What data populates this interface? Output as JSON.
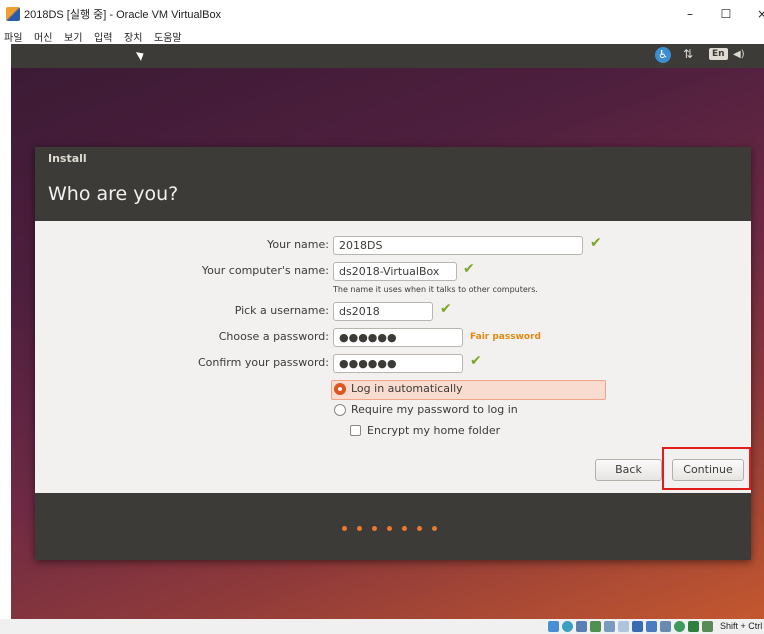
{
  "window": {
    "title": "2018DS [실행 중] - Oracle VM VirtualBox",
    "minimize": "–",
    "maximize": "☐",
    "close": "×"
  },
  "menu": [
    "파일",
    "머신",
    "보기",
    "입력",
    "장치",
    "도움말"
  ],
  "guest_topbar": {
    "language": "En",
    "network_glyph": "⇅",
    "volume_glyph": "◀)",
    "accessibility_glyph": "♿"
  },
  "dialog": {
    "section": "Install",
    "title": "Who are you?",
    "fields": {
      "your_name": {
        "label": "Your name:",
        "value": "2018DS"
      },
      "computer_name": {
        "label": "Your computer's name:",
        "value": "ds2018-VirtualBox",
        "hint": "The name it uses when it talks to other computers."
      },
      "username": {
        "label": "Pick a username:",
        "value": "ds2018"
      },
      "password": {
        "label": "Choose a password:",
        "value": "●●●●●●",
        "strength": "Fair password"
      },
      "confirm": {
        "label": "Confirm your password:",
        "value": "●●●●●●"
      }
    },
    "check_glyph": "✔",
    "login_options": {
      "auto": {
        "label": "Log in automatically",
        "selected": true
      },
      "require": {
        "label": "Require my password to log in",
        "selected": false
      },
      "encrypt": {
        "label": "Encrypt my home folder",
        "checked": false
      }
    },
    "buttons": {
      "back": "Back",
      "continue": "Continue"
    },
    "progress": {
      "total": 7
    }
  },
  "status": {
    "host_key": "Shift + Ctrl"
  },
  "colors": {
    "accent": "#e0541f",
    "highlight_box": "#e31c1c",
    "check": "#7aa62a",
    "strength": "#e08a13",
    "progress_dot": "#ea7a2c"
  }
}
